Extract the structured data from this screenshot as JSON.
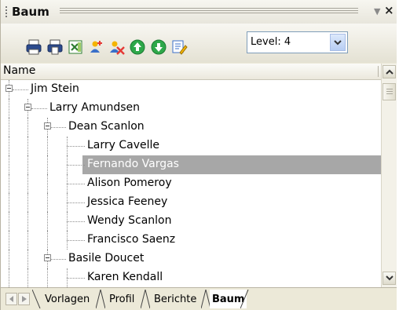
{
  "title": "Baum",
  "title_controls": {
    "menu": "▼",
    "close": "×"
  },
  "toolbar": {
    "buttons": [
      {
        "name": "print-icon"
      },
      {
        "name": "print-preview-icon"
      },
      {
        "name": "export-excel-icon"
      },
      {
        "name": "add-person-icon"
      },
      {
        "name": "delete-person-icon"
      },
      {
        "name": "arrow-up-icon"
      },
      {
        "name": "arrow-down-icon"
      },
      {
        "name": "edit-icon"
      }
    ],
    "level_label": "Level: 4"
  },
  "column": {
    "header": "Name"
  },
  "tree": {
    "rows": [
      {
        "label": "Jim Stein",
        "depth": 0,
        "expanded": true
      },
      {
        "label": "Larry  Amundsen",
        "depth": 1,
        "expanded": true
      },
      {
        "label": "Dean  Scanlon",
        "depth": 2,
        "expanded": true
      },
      {
        "label": "Larry  Cavelle",
        "depth": 3
      },
      {
        "label": "Fernando  Vargas",
        "depth": 3,
        "selected": true
      },
      {
        "label": "Alison  Pomeroy",
        "depth": 3
      },
      {
        "label": "Jessica  Feeney",
        "depth": 3
      },
      {
        "label": "Wendy  Scanlon",
        "depth": 3
      },
      {
        "label": "Francisco  Saenz",
        "depth": 3
      },
      {
        "label": "Basile  Doucet",
        "depth": 2,
        "expanded": true
      },
      {
        "label": "Karen  Kendall",
        "depth": 3
      }
    ]
  },
  "tabs": [
    {
      "label": "Vorlagen",
      "active": false
    },
    {
      "label": "Profil",
      "active": false
    },
    {
      "label": "Berichte",
      "active": false
    },
    {
      "label": "Baum",
      "active": true
    }
  ],
  "colors": {
    "selected_row": "#a7a7a7",
    "panel_bg": "#ece9d8",
    "combo_border": "#7f9db9"
  }
}
